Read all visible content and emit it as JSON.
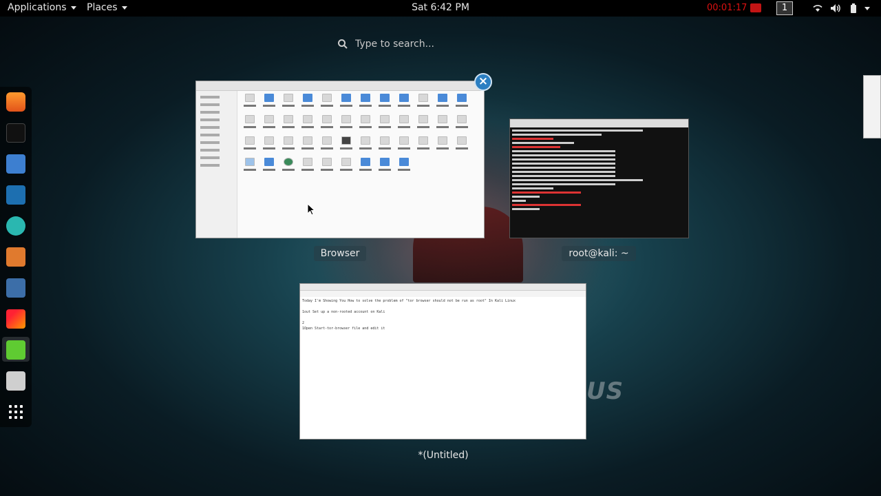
{
  "topbar": {
    "applications": "Applications",
    "places": "Places",
    "clock": "Sat  6:42 PM",
    "timer": "00:01:17",
    "workspace": "1"
  },
  "search": {
    "placeholder": "Type to search..."
  },
  "dock": {
    "items": [
      "firefox-icon",
      "terminal-icon",
      "files-icon",
      "metasploit-icon",
      "armitage-icon",
      "burpsuite-icon",
      "maltego-icon",
      "faraday-icon",
      "text-editor-icon",
      "other-app-icon",
      "show-apps-icon"
    ]
  },
  "windows": {
    "file_manager": {
      "caption": "Browser"
    },
    "terminal": {
      "caption": "root@kali: ~"
    },
    "editor": {
      "caption": "*(Untitled)",
      "lines": [
        "Today I'm Showing You How to solve the problem of \"tor browser should not be run as root\" In Kali Linux",
        "",
        "1out Set up a non-rooted account on Kali",
        "",
        "2",
        "1Open Start-tor-browser file and edit it"
      ]
    }
  },
  "colors": {
    "topbar_bg": "#000000",
    "timer": "#dd1111",
    "close_button": "#2b7fc2",
    "folder": "#4a8ad8"
  }
}
